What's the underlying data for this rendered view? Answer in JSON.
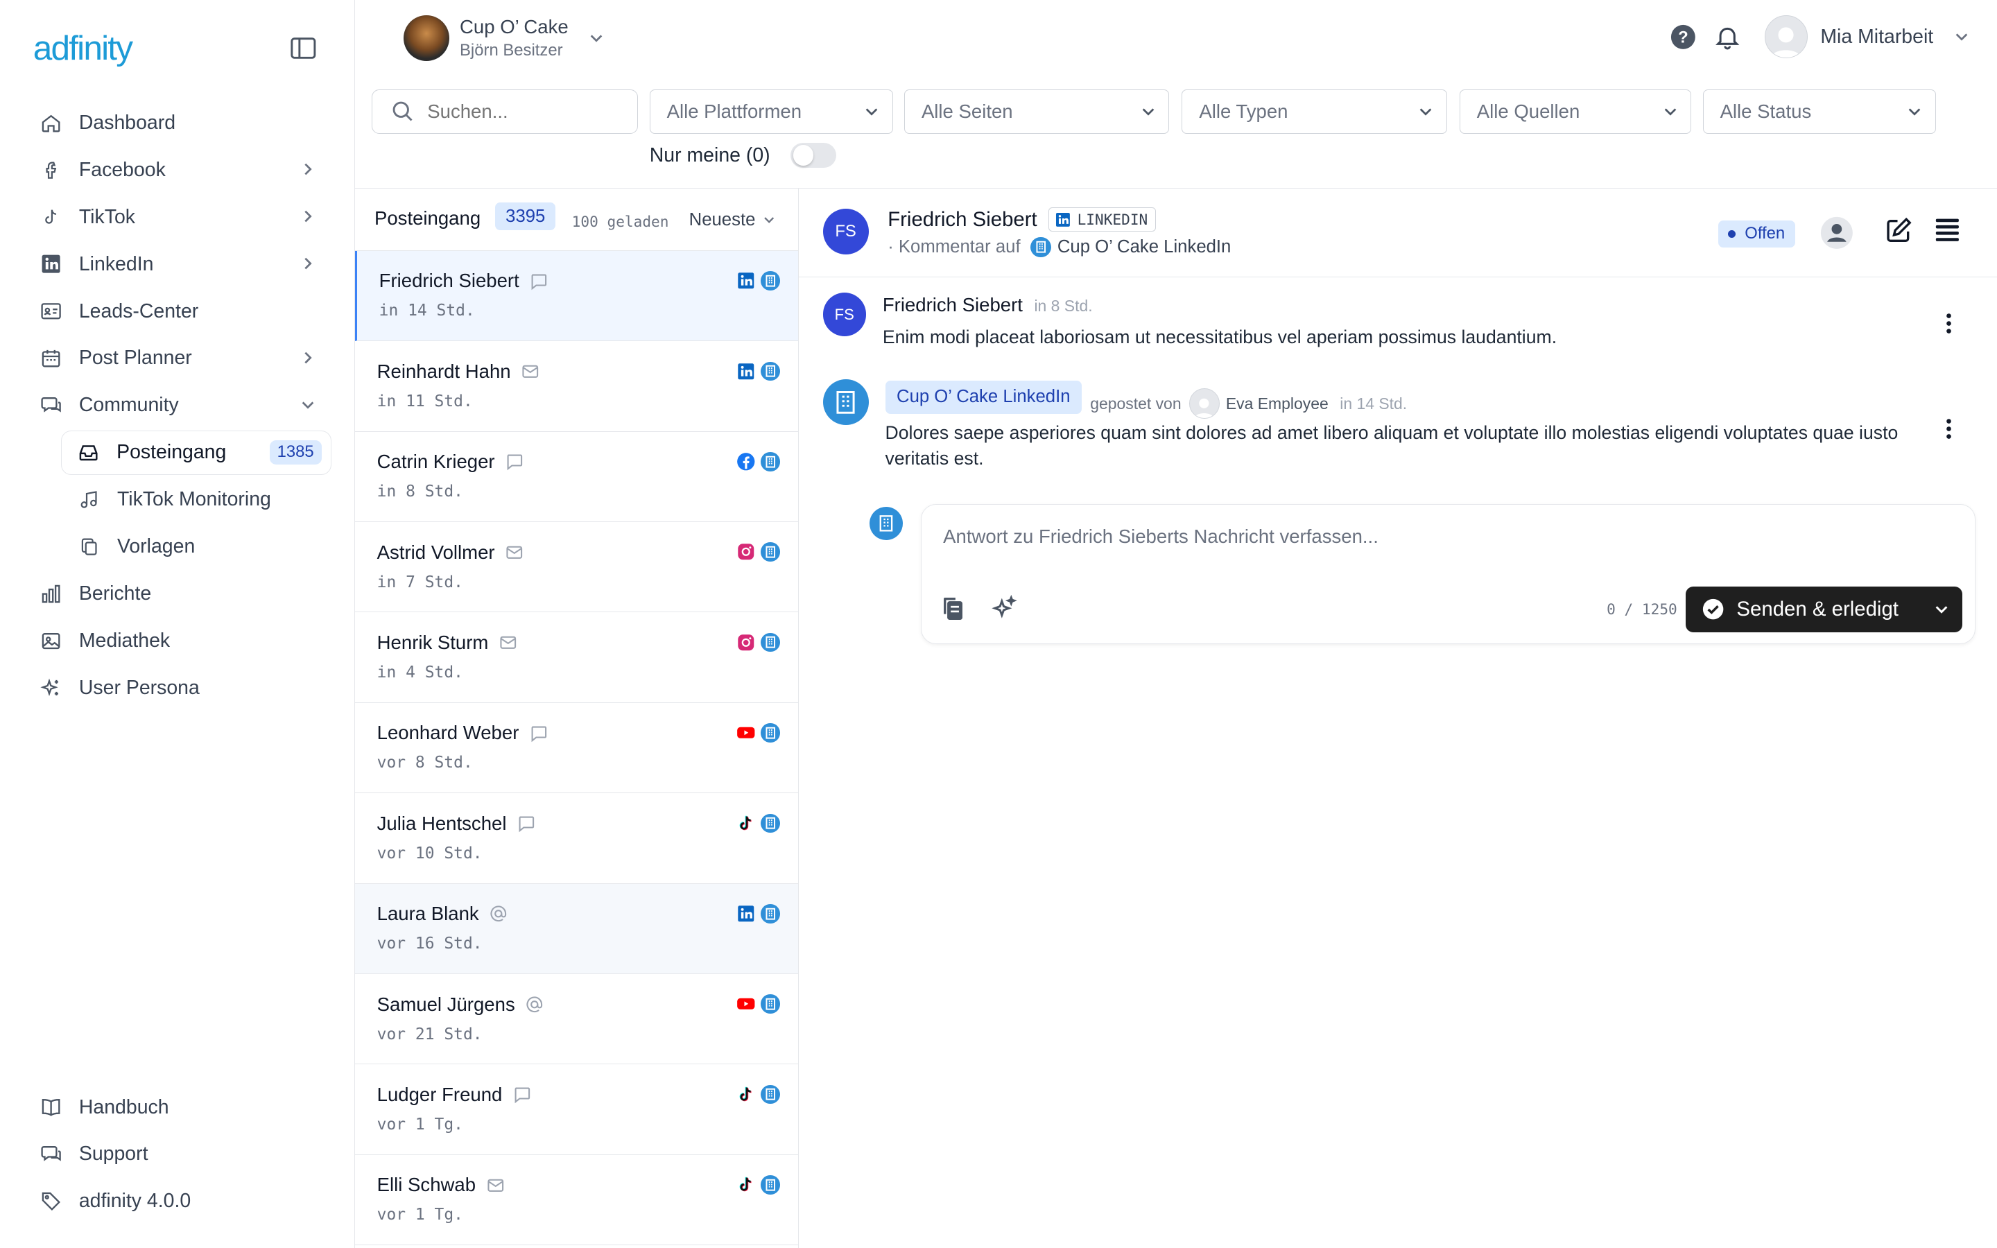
{
  "brand": {
    "logo": "adfinity",
    "accent": "#1d9bd7"
  },
  "sidebar": {
    "items": [
      {
        "label": "Dashboard",
        "icon": "home-icon"
      },
      {
        "label": "Facebook",
        "icon": "facebook-icon"
      },
      {
        "label": "TikTok",
        "icon": "tiktok-icon"
      },
      {
        "label": "LinkedIn",
        "icon": "linkedin-icon"
      },
      {
        "label": "Leads-Center",
        "icon": "id-card-icon"
      },
      {
        "label": "Post Planner",
        "icon": "calendar-icon"
      },
      {
        "label": "Community",
        "icon": "chat-icon"
      },
      {
        "label": "Posteingang",
        "icon": "inbox-icon",
        "badge": "1385"
      },
      {
        "label": "TikTok Monitoring",
        "icon": "music-icon"
      },
      {
        "label": "Vorlagen",
        "icon": "copy-icon"
      },
      {
        "label": "Berichte",
        "icon": "bar-chart-icon"
      },
      {
        "label": "Mediathek",
        "icon": "image-icon"
      },
      {
        "label": "User Persona",
        "icon": "sparkles-icon"
      }
    ],
    "bottom": [
      {
        "label": "Handbuch",
        "icon": "book-icon"
      },
      {
        "label": "Support",
        "icon": "chat-icon"
      },
      {
        "label": "adfinity 4.0.0",
        "icon": "tag-icon"
      }
    ]
  },
  "header": {
    "account_name": "Cup O’ Cake",
    "account_owner": "Björn Besitzer",
    "user_name": "Mia Mitarbeit"
  },
  "filters": {
    "search_placeholder": "Suchen...",
    "platforms": "Alle Plattformen",
    "pages": "Alle Seiten",
    "types": "Alle Typen",
    "sources": "Alle Quellen",
    "status": "Alle Status",
    "only_mine": "Nur meine (0)"
  },
  "inbox": {
    "title": "Posteingang",
    "count": "3395",
    "loaded": "100 geladen",
    "sort": "Neueste",
    "rows": [
      {
        "name": "Friedrich Siebert",
        "type": "comment",
        "time": "in 14 Std.",
        "platform": "linkedin"
      },
      {
        "name": "Reinhardt Hahn",
        "type": "message",
        "time": "in 11 Std.",
        "platform": "linkedin"
      },
      {
        "name": "Catrin Krieger",
        "type": "comment",
        "time": "in 8 Std.",
        "platform": "facebook"
      },
      {
        "name": "Astrid Vollmer",
        "type": "message",
        "time": "in 7 Std.",
        "platform": "instagram"
      },
      {
        "name": "Henrik Sturm",
        "type": "message",
        "time": "in 4 Std.",
        "platform": "instagram"
      },
      {
        "name": "Leonhard Weber",
        "type": "comment",
        "time": "vor 8 Std.",
        "platform": "youtube"
      },
      {
        "name": "Julia Hentschel",
        "type": "comment",
        "time": "vor 10 Std.",
        "platform": "tiktok"
      },
      {
        "name": "Laura Blank",
        "type": "mention",
        "time": "vor 16 Std.",
        "platform": "linkedin"
      },
      {
        "name": "Samuel Jürgens",
        "type": "mention",
        "time": "vor 21 Std.",
        "platform": "youtube"
      },
      {
        "name": "Ludger Freund",
        "type": "comment",
        "time": "vor 1 Tg.",
        "platform": "tiktok"
      },
      {
        "name": "Elli Schwab",
        "type": "message",
        "time": "vor 1 Tg.",
        "platform": "tiktok"
      }
    ]
  },
  "detail": {
    "initials": "FS",
    "name": "Friedrich Siebert",
    "platform_label": "LINKEDIN",
    "sub_prefix": "· Kommentar auf",
    "page_name": "Cup O’ Cake LinkedIn",
    "status": "Offen",
    "message": {
      "author": "Friedrich Siebert",
      "time": "in 8 Std.",
      "text": "Enim modi placeat laboriosam ut necessitatibus vel aperiam possimus laudantium."
    },
    "post": {
      "page": "Cup O’ Cake LinkedIn",
      "posted_by": "gepostet von",
      "author": "Eva Employee",
      "time": "in 14 Std.",
      "text": "Dolores saepe asperiores quam sint dolores ad amet libero aliquam et voluptate illo molestias eligendi voluptates quae iusto veritatis est."
    },
    "reply": {
      "placeholder": "Antwort zu Friedrich Sieberts Nachricht verfassen...",
      "char_count": "0 / 1250",
      "send_label": "Senden & erledigt"
    }
  }
}
